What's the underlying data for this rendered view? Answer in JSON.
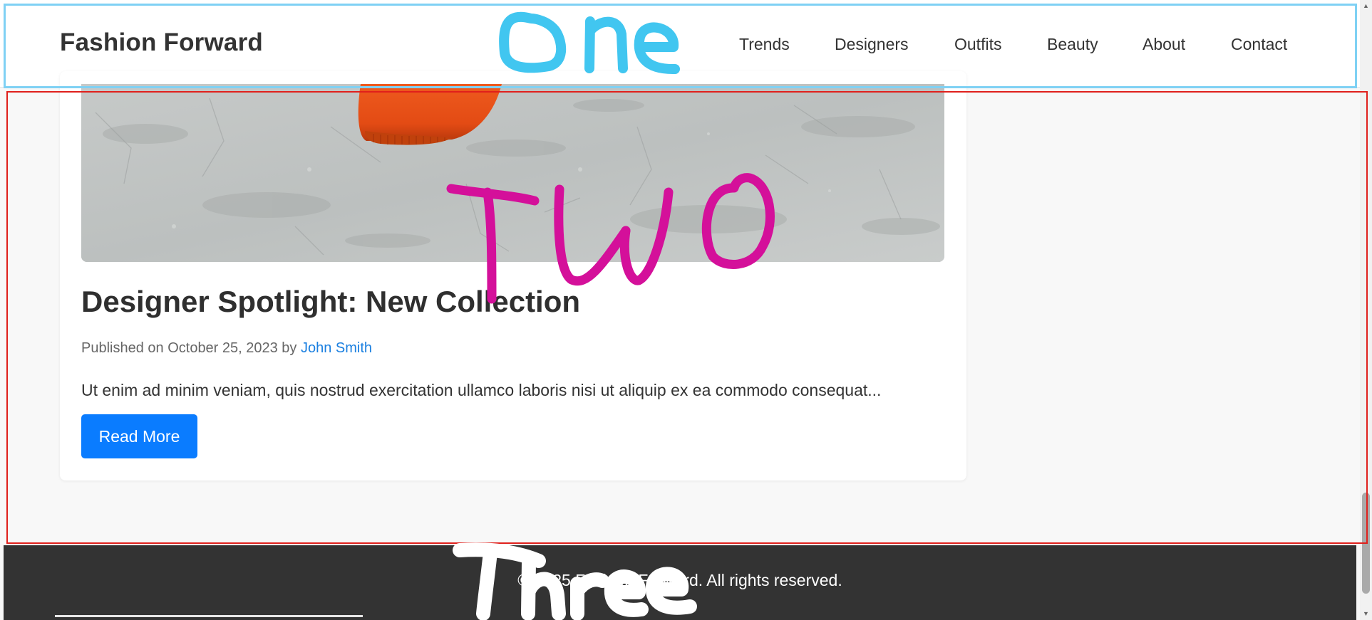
{
  "header": {
    "logo": "Fashion Forward",
    "nav": [
      "Trends",
      "Designers",
      "Outfits",
      "Beauty",
      "About",
      "Contact"
    ]
  },
  "post": {
    "title": "Designer Spotlight: New Collection",
    "meta_prefix": "Published on October 25, 2023 by ",
    "author": "John Smith",
    "excerpt": "Ut enim ad minim veniam, quis nostrud exercitation ullamco laboris nisi ut aliquip ex ea commodo consequat...",
    "read_more_label": "Read More"
  },
  "footer": {
    "copyright": "© 2025 Fashion Forward. All rights reserved."
  },
  "annotations": {
    "labels": [
      "One",
      "Two",
      "Three"
    ],
    "colors": {
      "one": "#41c6f0",
      "two": "#d4109a",
      "three": "#ffffff",
      "box_one": "#7fd1f4",
      "box_two": "#e0201c"
    }
  },
  "icons": {
    "scroll_up": "scroll-up-arrow-icon",
    "scroll_down": "scroll-down-arrow-icon"
  }
}
